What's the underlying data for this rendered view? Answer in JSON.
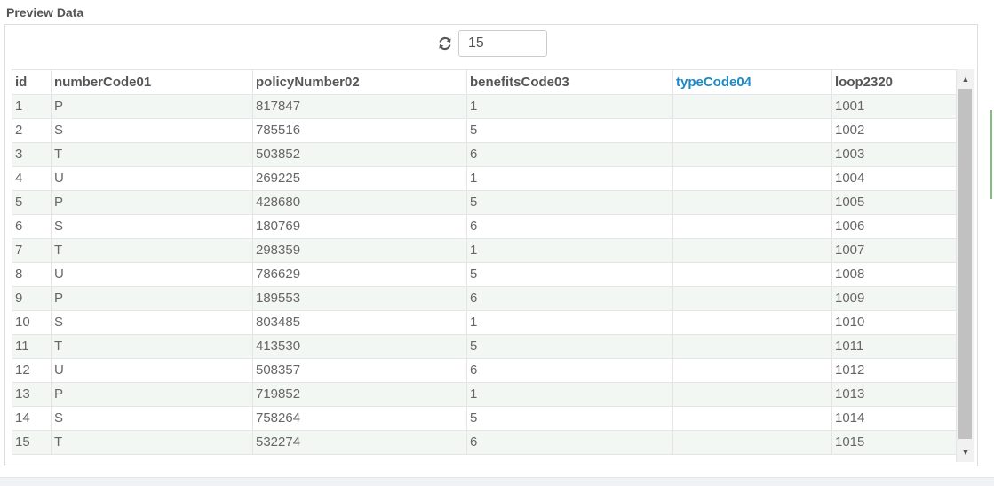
{
  "section": {
    "title": "Preview Data"
  },
  "toolbar": {
    "refresh_icon": "refresh-icon",
    "rows_value": "15"
  },
  "grid": {
    "columns": [
      "id",
      "numberCode01",
      "policyNumber02",
      "benefitsCode03",
      "typeCode04",
      "loop2320"
    ],
    "active_column": "typeCode04",
    "rows": [
      [
        "1",
        "P",
        "817847",
        "1",
        "",
        "1001"
      ],
      [
        "2",
        "S",
        "785516",
        "5",
        "",
        "1002"
      ],
      [
        "3",
        "T",
        "503852",
        "6",
        "",
        "1003"
      ],
      [
        "4",
        "U",
        "269225",
        "1",
        "",
        "1004"
      ],
      [
        "5",
        "P",
        "428680",
        "5",
        "",
        "1005"
      ],
      [
        "6",
        "S",
        "180769",
        "6",
        "",
        "1006"
      ],
      [
        "7",
        "T",
        "298359",
        "1",
        "",
        "1007"
      ],
      [
        "8",
        "U",
        "786629",
        "5",
        "",
        "1008"
      ],
      [
        "9",
        "P",
        "189553",
        "6",
        "",
        "1009"
      ],
      [
        "10",
        "S",
        "803485",
        "1",
        "",
        "1010"
      ],
      [
        "11",
        "T",
        "413530",
        "5",
        "",
        "1011"
      ],
      [
        "12",
        "U",
        "508357",
        "6",
        "",
        "1012"
      ],
      [
        "13",
        "P",
        "719852",
        "1",
        "",
        "1013"
      ],
      [
        "14",
        "S",
        "758264",
        "5",
        "",
        "1014"
      ],
      [
        "15",
        "T",
        "532274",
        "6",
        "",
        "1015"
      ]
    ]
  },
  "colors": {
    "active_header": "#1a8bc8",
    "stripe": "#f3f7f3",
    "border": "#e5e5e5"
  }
}
